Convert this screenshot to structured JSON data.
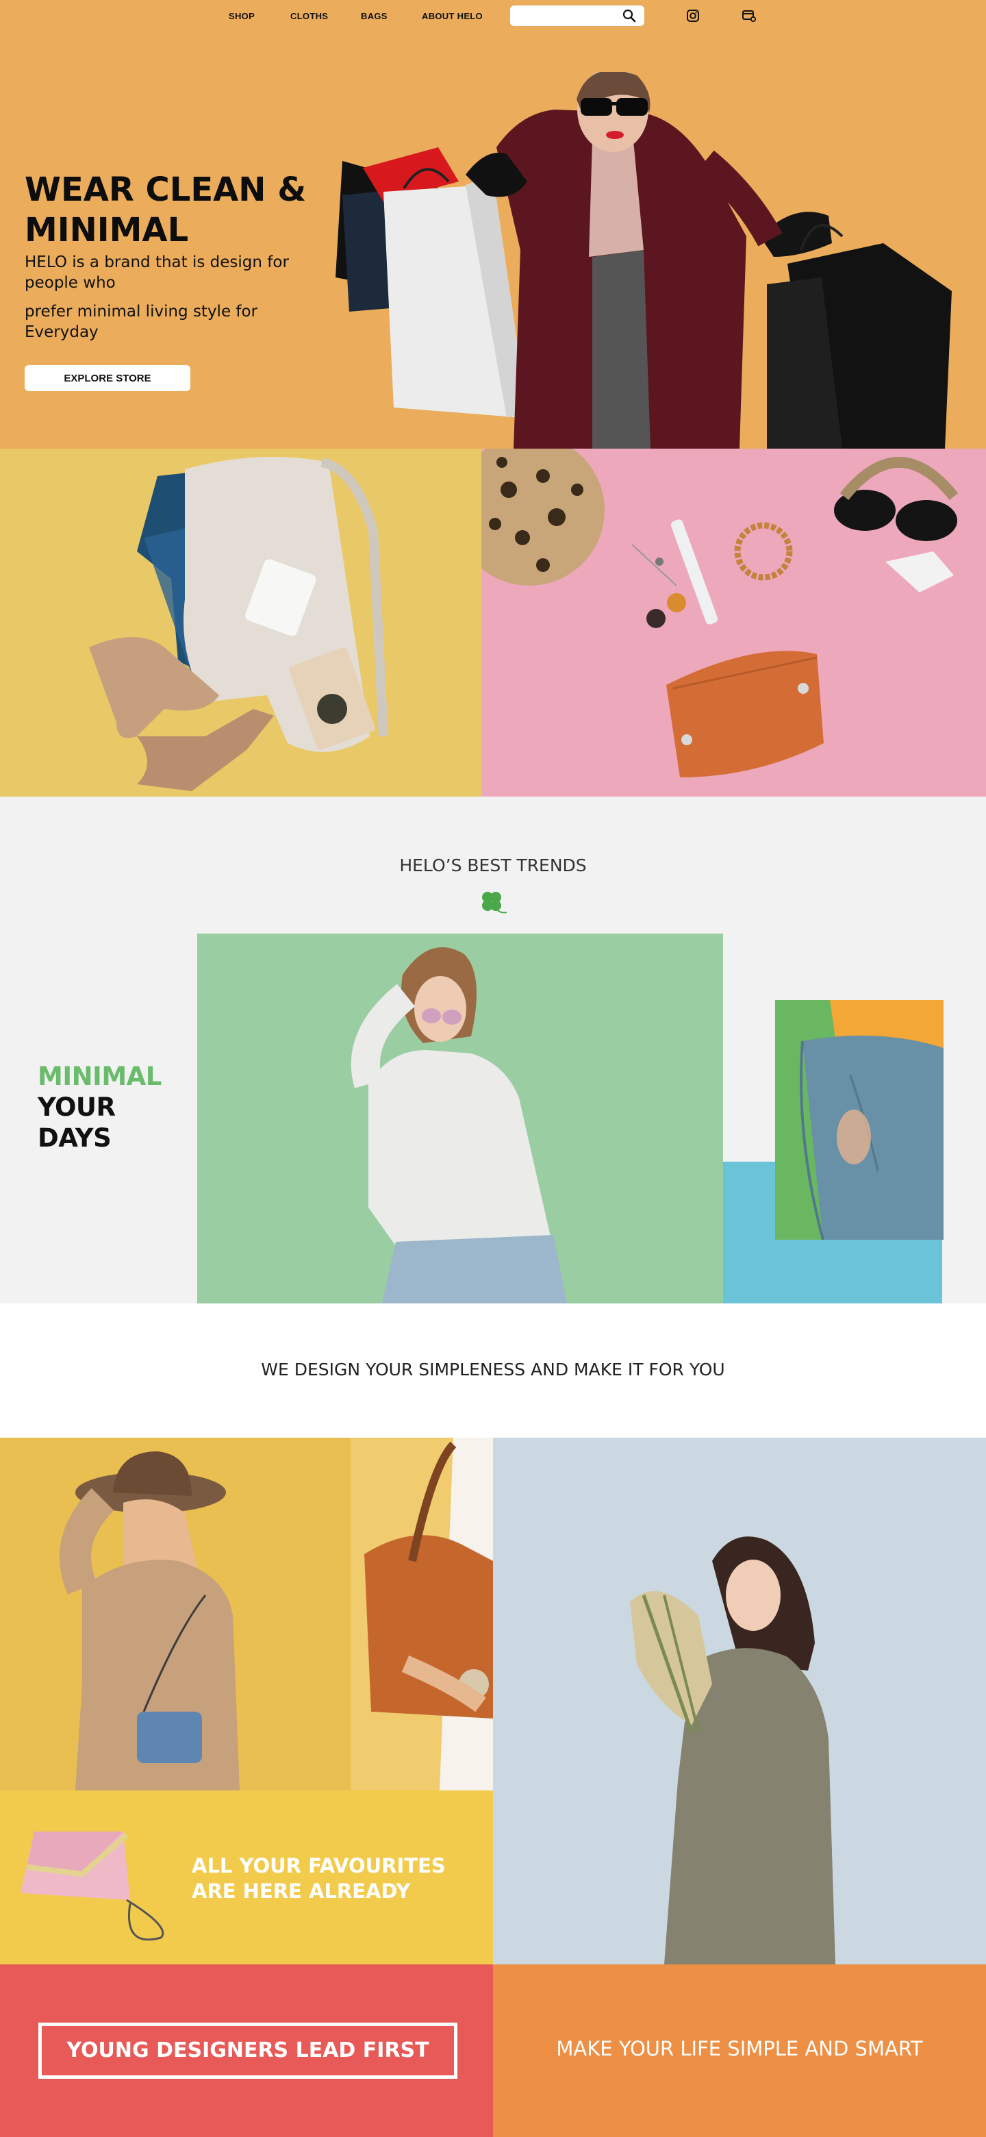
{
  "nav": {
    "links": [
      "SHOP",
      "CLOTHS",
      "BAGS",
      "ABOUT HELO"
    ],
    "search_placeholder": "",
    "icons": [
      "search-icon",
      "instagram-icon",
      "cart-icon"
    ]
  },
  "hero": {
    "title_line1": "WEAR CLEAN &",
    "title_line2": "MINIMAL",
    "desc_line1": "HELO is a brand that is design for people who",
    "desc_line2": "prefer minimal living style for Everyday",
    "cta": "EXPLORE STORE"
  },
  "trends": {
    "title": "HELO’S BEST TRENDS",
    "tagline_line1": "MINIMAL",
    "tagline_line2": "YOUR",
    "tagline_line3": "DAYS"
  },
  "design": {
    "title": "WE DESIGN YOUR SIMPLENESS AND MAKE IT FOR YOU"
  },
  "favourites": {
    "line1": "ALL YOUR FAVOURITES",
    "line2": "ARE HERE ALREADY"
  },
  "footer": {
    "left": "YOUNG DESIGNERS LEAD FIRST",
    "right": "MAKE YOUR LIFE SIMPLE AND SMART"
  },
  "colors": {
    "hero_bg": "#EBAC5B",
    "flatlay_yellow": "#E9C867",
    "accessories_pink": "#EEA8BC",
    "trends_bg": "#F2F2F2",
    "green_panel": "#9BCDA3",
    "accent_green": "#6ABB6C",
    "blue_block": "#6AC3D6",
    "fav_yellow": "#F2CB4C",
    "light_blue": "#CCD8E1",
    "footer_red": "#E75A57",
    "footer_orange": "#ED9045"
  }
}
